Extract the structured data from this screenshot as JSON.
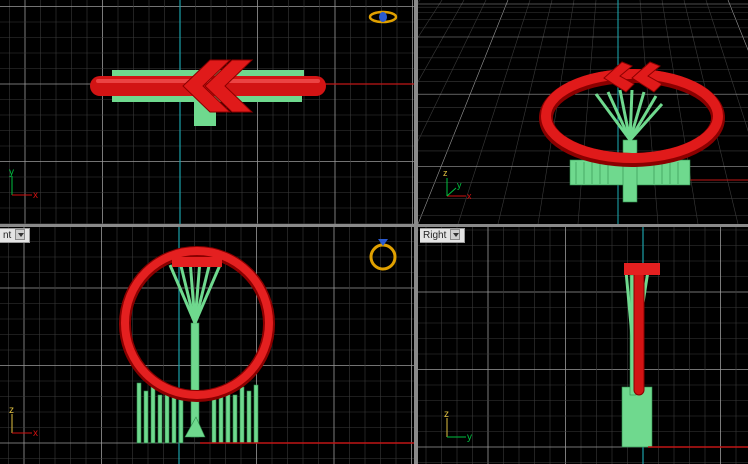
{
  "viewports": [
    {
      "id": "top",
      "tab_label": "",
      "axes": [
        "y",
        "x"
      ],
      "gizmo": "ring-top-icon"
    },
    {
      "id": "perspective",
      "tab_label": "",
      "axes": [
        "z",
        "x",
        "y"
      ],
      "gizmo": ""
    },
    {
      "id": "front",
      "tab_label": "nt",
      "axes": [
        "z",
        "x"
      ],
      "gizmo": "ring-front-icon"
    },
    {
      "id": "right",
      "tab_label": "Right",
      "axes": [
        "z",
        "y"
      ],
      "gizmo": ""
    }
  ],
  "colors": {
    "background": "#000000",
    "grid_minor": "#3a3a3a",
    "grid_major": "#9a9a9a",
    "axis_x": "#c01616",
    "axis_y": "#1aa0a8",
    "model_ring": "#e01a1a",
    "model_supports": "#6fd98e",
    "viewport_border": "#8a8a8a"
  }
}
